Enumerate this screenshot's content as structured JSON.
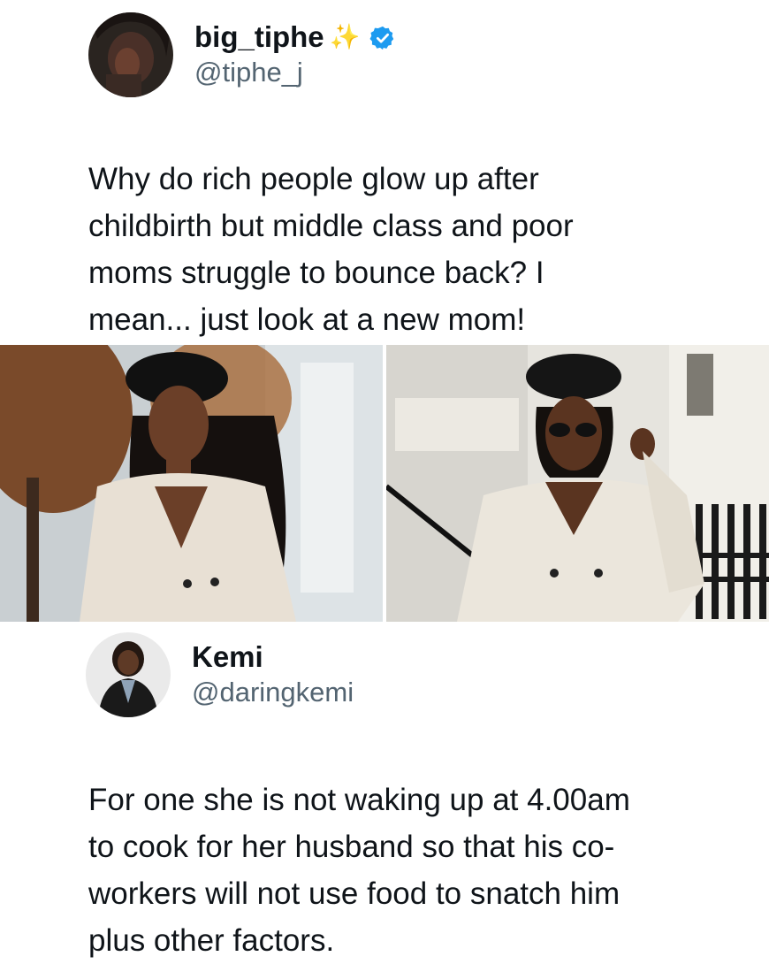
{
  "tweet1": {
    "display_name": "big_tiphe",
    "emoji": "✨",
    "handle": "@tiphe_j",
    "text": "Why do rich people glow up after\nchildbirth but middle class and poor\nmoms struggle to bounce back? I\nmean... just look at a new mom!",
    "verified": true
  },
  "tweet2": {
    "display_name": "Kemi",
    "handle": "@daringkemi",
    "text": "For one she is not waking up at 4.00am\nto cook for her husband so that his co-\nworkers will not use food to snatch him\nplus other factors."
  },
  "colors": {
    "handle": "#536471",
    "verified": "#1d9bf0",
    "text": "#0f1419"
  }
}
